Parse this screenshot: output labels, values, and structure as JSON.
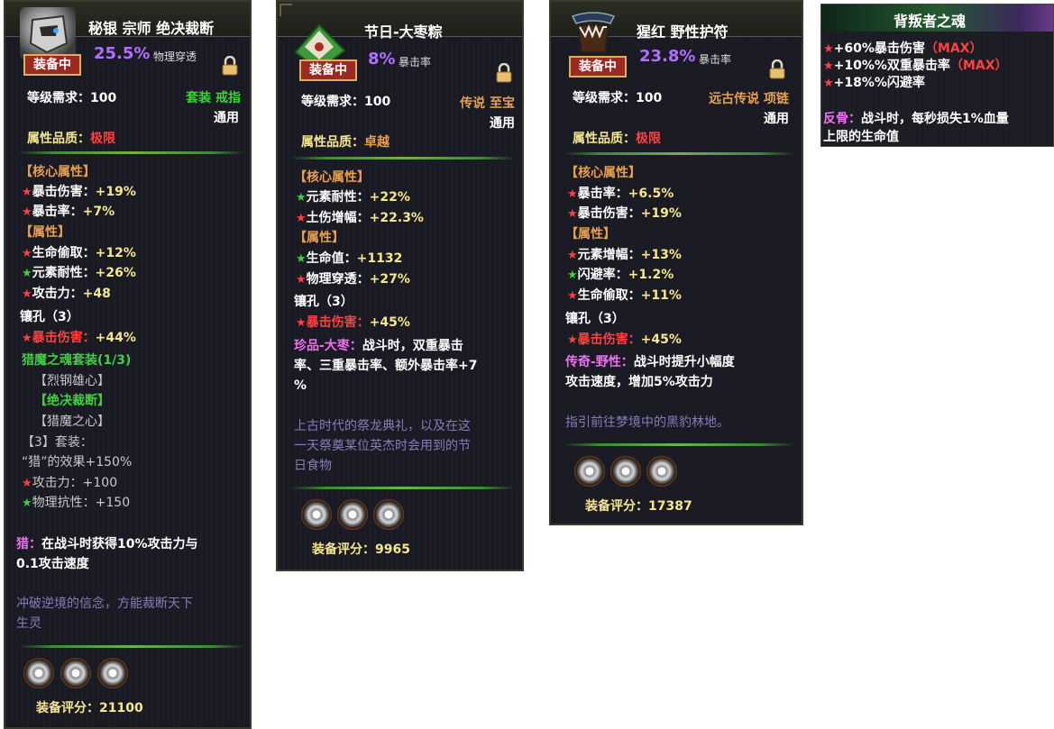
{
  "cards": [
    {
      "name": "秘银 宗师 绝决裁断",
      "equipped": "装备中",
      "percent": "25.5%",
      "percent_label": "物理穿透",
      "level_req": "等级需求：100",
      "set_type": "套装 戒指",
      "usage": "通用",
      "quality_label": "属性品质：",
      "quality_value": "极限",
      "core_header": "【核心属性】",
      "core": [
        {
          "star": "red",
          "label": "暴击伤害：",
          "value": "+19%"
        },
        {
          "star": "red",
          "label": "暴击率：",
          "value": "+7%"
        }
      ],
      "attr_header": "【属性】",
      "attrs": [
        {
          "star": "red",
          "label": "生命偷取：",
          "value": "+12%"
        },
        {
          "star": "green",
          "label": "元素耐性：",
          "value": "+26%"
        },
        {
          "star": "red",
          "label": "攻击力：",
          "value": "+48"
        }
      ],
      "sockets": "镶孔（3）",
      "socket_stat": {
        "star": "red",
        "label": "暴击伤害：",
        "value": "+44%"
      },
      "set_name": "猎魔之魂套装(1/3)",
      "set_items": [
        "【烈钢雄心】",
        "【绝决裁断】",
        "【猎魔之心】"
      ],
      "set_bonus_title": "【3】套装：",
      "set_bonus_effect": "“猎”的效果+150%",
      "set_bonus_stats": [
        {
          "star": "red",
          "label": "攻击力：",
          "value": "+100"
        },
        {
          "star": "green",
          "label": "物理抗性：",
          "value": "+150"
        }
      ],
      "special_name": "猎：",
      "special_text_1": "在战斗时获得10%攻击力与",
      "special_text_2": "0.1攻击速度",
      "lore_1": "冲破逆境的信念，方能裁断天下",
      "lore_2": "生灵",
      "score": "装备评分：21100"
    },
    {
      "name": "节日-大枣粽",
      "equipped": "装备中",
      "percent": "8%",
      "percent_label": "暴击率",
      "level_req": "等级需求：100",
      "set_type": "传说 至宝",
      "usage": "通用",
      "quality_label": "属性品质：",
      "quality_value": "卓越",
      "core_header": "【核心属性】",
      "core": [
        {
          "star": "green",
          "label": "元素耐性：",
          "value": "+22%"
        },
        {
          "star": "red",
          "label": "土伤增幅：",
          "value": "+22.3%"
        }
      ],
      "attr_header": "【属性】",
      "attrs": [
        {
          "star": "green",
          "label": "生命值：",
          "value": "+1132"
        },
        {
          "star": "red",
          "label": "物理穿透：",
          "value": "+27%"
        }
      ],
      "sockets": "镶孔（3）",
      "socket_stat": {
        "star": "red",
        "label": "暴击伤害：",
        "value": "+45%"
      },
      "special_name": "珍品-大枣：",
      "special_text_1": "战斗时，双重暴击",
      "special_text_2": "率、三重暴击率、额外暴击率+7",
      "special_text_3": "%",
      "lore_1": "上古时代的祭龙典礼，以及在这",
      "lore_2": "一天祭奠某位英杰时会用到的节",
      "lore_3": "日食物",
      "score": "装备评分：9965"
    },
    {
      "name": "猩红 野性护符",
      "equipped": "装备中",
      "percent": "23.8%",
      "percent_label": "暴击率",
      "level_req": "等级需求：100",
      "set_type": "远古传说 项链",
      "usage": "通用",
      "quality_label": "属性品质：",
      "quality_value": "极限",
      "core_header": "【核心属性】",
      "core": [
        {
          "star": "red",
          "label": "暴击率：",
          "value": "+6.5%"
        },
        {
          "star": "red",
          "label": "暴击伤害：",
          "value": "+19%"
        }
      ],
      "attr_header": "【属性】",
      "attrs": [
        {
          "star": "red",
          "label": "元素增幅：",
          "value": "+13%"
        },
        {
          "star": "green",
          "label": "闪避率：",
          "value": "+1.2%"
        },
        {
          "star": "red",
          "label": "生命偷取：",
          "value": "+11%"
        }
      ],
      "sockets": "镶孔（3）",
      "socket_stat": {
        "star": "red",
        "label": "暴击伤害：",
        "value": "+45%"
      },
      "special_name": "传奇-野性：",
      "special_text_1": "战斗时提升小幅度",
      "special_text_2": "攻击速度，增加5%攻击力",
      "lore_1": "指引前往梦境中的黑豹林地。",
      "score": "装备评分：17387"
    }
  ],
  "soul": {
    "title": "背叛者之魂",
    "lines": [
      {
        "text": "+60%暴击伤害",
        "max": "（MAX）"
      },
      {
        "text": "+10%%双重暴击率",
        "max": "（MAX）"
      },
      {
        "text": "+18%%闪避率",
        "max": ""
      }
    ],
    "special_name": "反骨：",
    "special_text_1": "战斗时，每秒损失1%血量",
    "special_text_2": "上限的生命值"
  }
}
